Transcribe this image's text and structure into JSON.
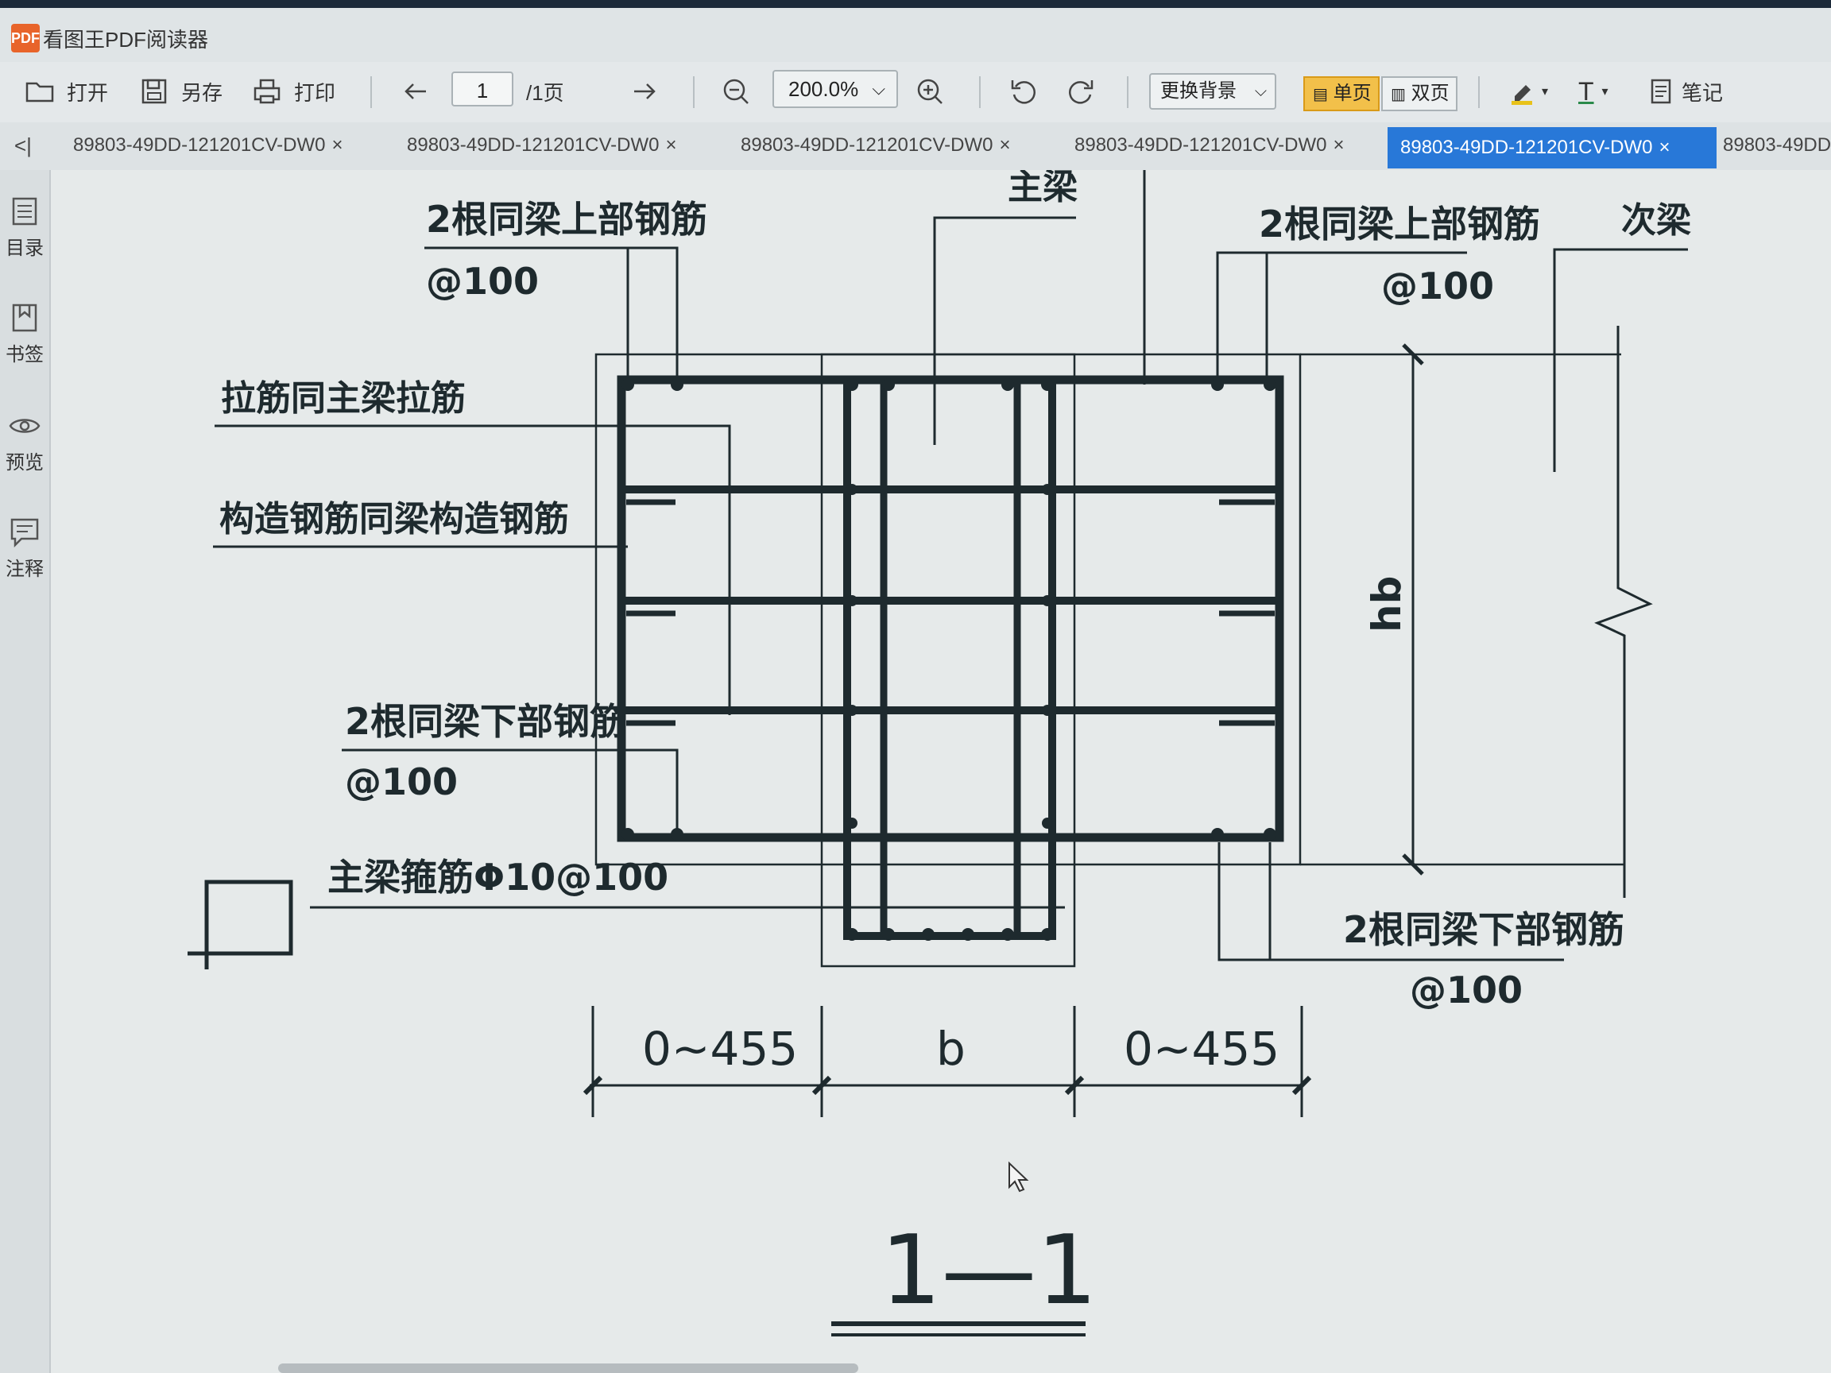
{
  "app": {
    "icon": "PDF",
    "title": "看图王PDF阅读器"
  },
  "toolbar": {
    "open_label": "打开",
    "saveas_label": "另存",
    "print_label": "打印",
    "page_current": "1",
    "page_total": "/1页",
    "zoom_value": "200.0%",
    "background_label": "更换背景",
    "single_page_label": "单页",
    "double_page_label": "双页",
    "notes_label": "笔记",
    "text_tool_label": "T"
  },
  "tabs": [
    {
      "label": "89803-49DD-121201CV-DW0"
    },
    {
      "label": "89803-49DD-121201CV-DW0"
    },
    {
      "label": "89803-49DD-121201CV-DW0"
    },
    {
      "label": "89803-49DD-121201CV-DW0"
    },
    {
      "label": "89803-49DD-121201CV-DW0"
    },
    {
      "label": "89803-49DD"
    }
  ],
  "tab_close": "×",
  "tab_collapse": "<|",
  "sidebar": {
    "items": [
      {
        "label": "目录",
        "icon": "list-icon"
      },
      {
        "label": "书签",
        "icon": "bookmark-icon"
      },
      {
        "label": "预览",
        "icon": "eye-icon"
      },
      {
        "label": "注释",
        "icon": "comment-icon"
      }
    ]
  },
  "drawing": {
    "main_beam": "主梁",
    "secondary_beam": "次梁",
    "top_left_label": "2根同梁上部钢筋",
    "top_left_spacing": "@100",
    "top_right_label": "2根同梁上部钢筋",
    "top_right_spacing": "@100",
    "tie_label": "拉筋同主梁拉筋",
    "structural_label": "构造钢筋同梁构造钢筋",
    "bottom_left_label": "2根同梁下部钢筋",
    "bottom_left_spacing": "@100",
    "stirrup_label": "主梁箍筋Φ10@100",
    "bottom_right_label": "2根同梁下部钢筋",
    "bottom_right_spacing": "@100",
    "height_label": "hb",
    "dim_left": "0~455",
    "dim_mid": "b",
    "dim_right": "0~455",
    "section_title": "1—1"
  }
}
